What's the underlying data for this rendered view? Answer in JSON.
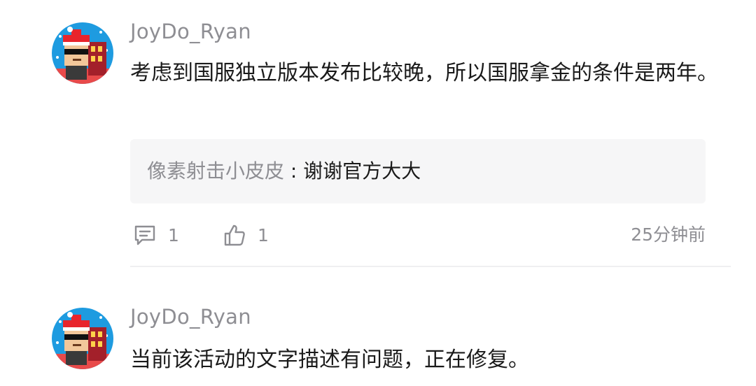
{
  "comments": [
    {
      "username": "JoyDo_Ryan",
      "content": "考虑到国服独立版本发布比较晚，所以国服拿金的条件是两年。",
      "reply": {
        "author": "像素射击小皮皮",
        "separator": " : ",
        "text": "谢谢官方大大"
      },
      "reply_count": "1",
      "like_count": "1",
      "time": "25分钟前"
    },
    {
      "username": "JoyDo_Ryan",
      "content": "当前该活动的文字描述有问题，正在修复。"
    }
  ],
  "icons": {
    "reply": "comment-bubble-icon",
    "like": "thumbs-up-icon"
  },
  "colors": {
    "username": "#8e8e93",
    "text": "#1a1a1a",
    "reply_bg": "#f6f6f7",
    "divider": "#efeff1",
    "avatar_bg": "#1e9be0"
  }
}
